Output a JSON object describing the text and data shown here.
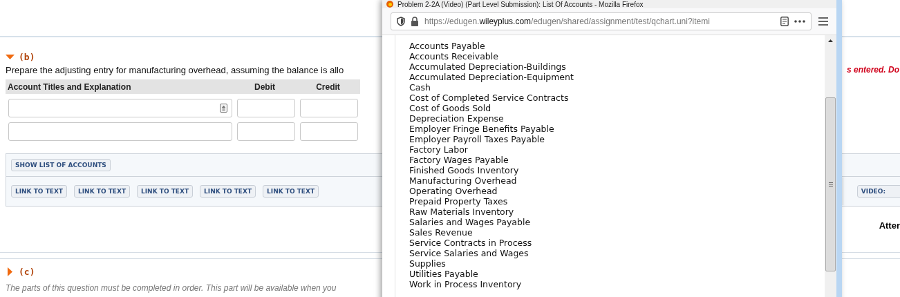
{
  "page": {
    "part_b": {
      "label": "(b)",
      "expanded": true,
      "instruction": "Prepare the adjusting entry for manufacturing overhead, assuming the balance is allo",
      "instruction_tail": "s entered. Do",
      "table": {
        "columns": [
          "Account Titles and Explanation",
          "Debit",
          "Credit"
        ],
        "rows": [
          {
            "kind": "dropdown"
          },
          {
            "kind": "text"
          }
        ]
      },
      "show_list_button": "SHOW LIST OF ACCOUNTS",
      "link_buttons": [
        "LINK TO TEXT",
        "LINK TO TEXT",
        "LINK TO TEXT",
        "LINK TO TEXT",
        "LINK TO TEXT"
      ],
      "video_button": "VIDEO:",
      "attempts_label": "Atter"
    },
    "part_c": {
      "label": "(c)",
      "expanded": false,
      "note": "The parts of this question must be completed in order. This part will be available when you"
    }
  },
  "popup": {
    "title": "Problem 2-2A (Video) (Part Level Submission): List Of Accounts - Mozilla Firefox",
    "url": {
      "prefix": "https://edugen.",
      "domain": "wileyplus.com",
      "path": "/edugen/shared/assignment/test/qchart.uni?itemi"
    },
    "accounts": [
      "Accounts Payable",
      "Accounts Receivable",
      "Accumulated Depreciation-Buildings",
      "Accumulated Depreciation-Equipment",
      "Cash",
      "Cost of Completed Service Contracts",
      "Cost of Goods Sold",
      "Depreciation Expense",
      "Employer Fringe Benefits Payable",
      "Employer Payroll Taxes Payable",
      "Factory Labor",
      "Factory Wages Payable",
      "Finished Goods Inventory",
      "Manufacturing Overhead",
      "Operating Overhead",
      "Prepaid Property Taxes",
      "Raw Materials Inventory",
      "Salaries and Wages Payable",
      "Sales Revenue",
      "Service Contracts in Process",
      "Service Salaries and Wages",
      "Supplies",
      "Utilities Payable",
      "Work in Process Inventory"
    ]
  }
}
